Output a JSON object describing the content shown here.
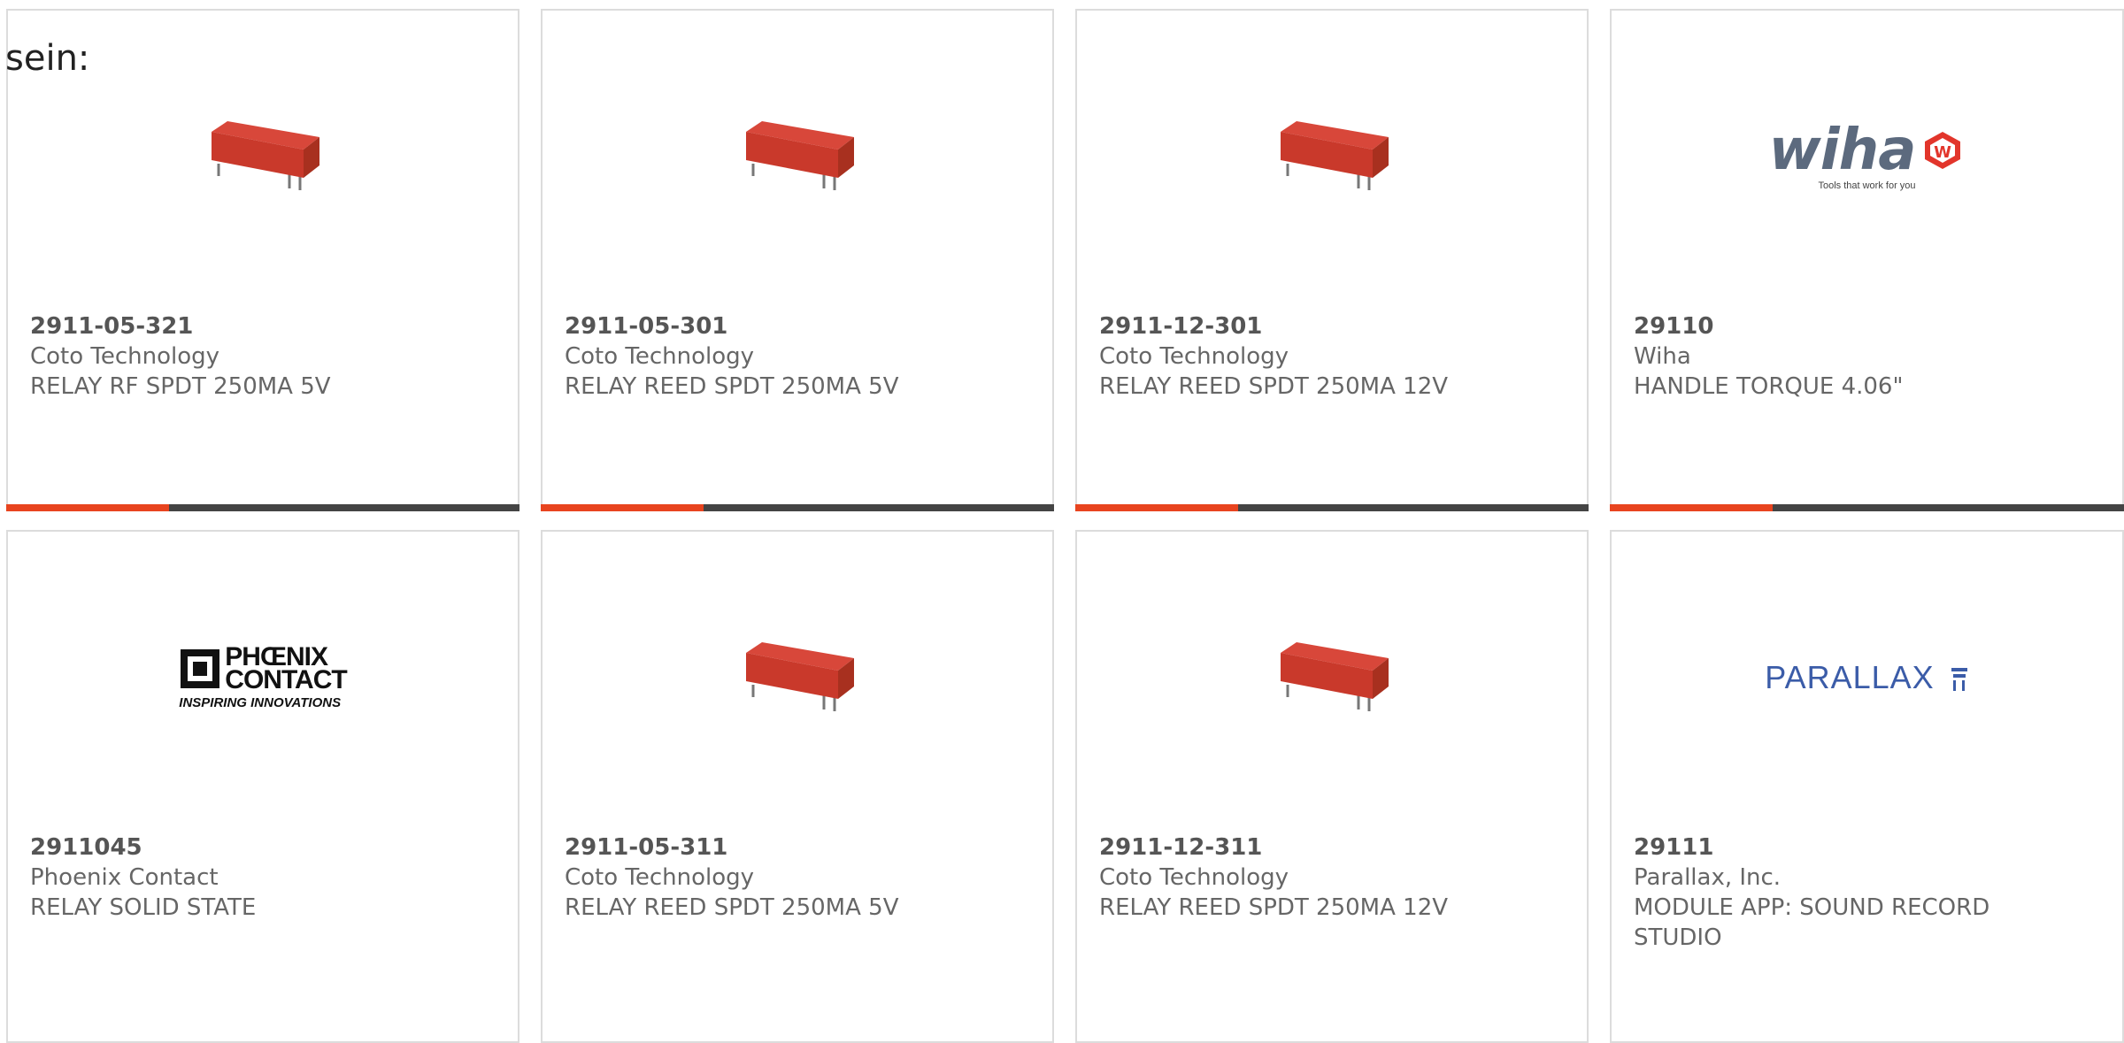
{
  "prefix_text": "sein:",
  "colors": {
    "card_border": "#dcdcdc",
    "bar_dark": "#444444",
    "bar_accent": "#e8441f",
    "relay_red": "#c9392b",
    "wiha_text": "#5c6a7e",
    "wiha_red": "#e2352b",
    "parallax_blue": "#3b5ca8"
  },
  "products": [
    {
      "part_number": "2911-05-321",
      "manufacturer": "Coto Technology",
      "description": "RELAY RF SPDT 250MA 5V",
      "image": "red-reed-relay"
    },
    {
      "part_number": "2911-05-301",
      "manufacturer": "Coto Technology",
      "description": "RELAY REED SPDT 250MA 5V",
      "image": "red-reed-relay"
    },
    {
      "part_number": "2911-12-301",
      "manufacturer": "Coto Technology",
      "description": "RELAY REED SPDT 250MA 12V",
      "image": "red-reed-relay"
    },
    {
      "part_number": "29110",
      "manufacturer": "Wiha",
      "description": "HANDLE TORQUE 4.06\"",
      "image": "wiha-logo",
      "logo": {
        "word": "wiha",
        "tagline": "Tools that work for you",
        "mark": "W"
      }
    },
    {
      "part_number": "2911045",
      "manufacturer": "Phoenix Contact",
      "description": "RELAY SOLID STATE",
      "image": "phoenix-contact-logo",
      "logo": {
        "line1": "PHŒNIX",
        "line2": "CONTACT",
        "tagline": "INSPIRING INNOVATIONS"
      }
    },
    {
      "part_number": "2911-05-311",
      "manufacturer": "Coto Technology",
      "description": "RELAY REED SPDT 250MA 5V",
      "image": "red-reed-relay"
    },
    {
      "part_number": "2911-12-311",
      "manufacturer": "Coto Technology",
      "description": "RELAY REED SPDT 250MA 12V",
      "image": "red-reed-relay"
    },
    {
      "part_number": "29111",
      "manufacturer": "Parallax, Inc.",
      "description": "MODULE APP: SOUND RECORD STUDIO",
      "image": "parallax-logo",
      "logo": {
        "word": "PARALLAX"
      }
    }
  ]
}
